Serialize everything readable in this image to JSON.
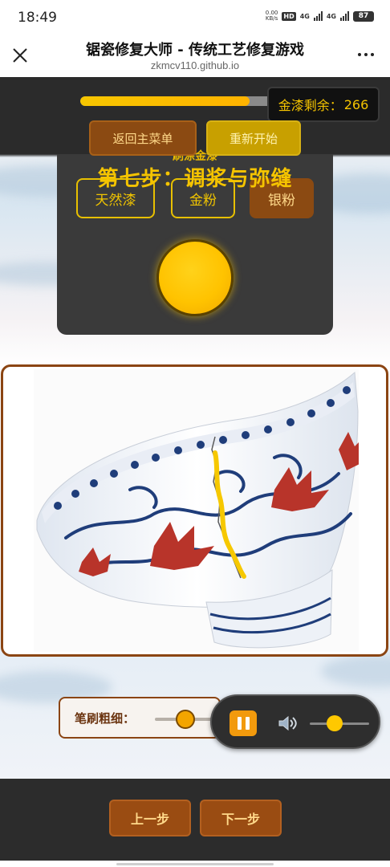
{
  "status_bar": {
    "time": "18:49",
    "net_speed_value": "0.00",
    "net_speed_unit": "KB/s",
    "hd_label": "HD",
    "signal_1": "4G",
    "signal_2": "4G",
    "battery": "87"
  },
  "browser": {
    "title": "锯瓷修复大师 - 传统工艺修复游戏",
    "url": "zkmcv110.github.io",
    "close_icon": "close-icon",
    "more_icon": "more-dots-icon"
  },
  "game": {
    "progress_percent": 88,
    "gold_label": "金漆剩余：",
    "gold_value": "266",
    "menu_button": "返回主菜单",
    "restart_button": "重新开始",
    "panel_subtitle": "刷涂金漆",
    "step_title": "第七步：调浆与弥缝",
    "materials": [
      "天然漆",
      "金粉",
      "银粉"
    ],
    "brush_label": "笔刷粗细：",
    "brush_value_fraction": 0.45,
    "volume_fraction": 0.35,
    "prev_button": "上一步",
    "next_button": "下一步"
  },
  "colors": {
    "gold": "#f5c400",
    "brown": "#8b4513",
    "orange": "#f29a0d",
    "dark_panel": "#3a3a3a"
  }
}
